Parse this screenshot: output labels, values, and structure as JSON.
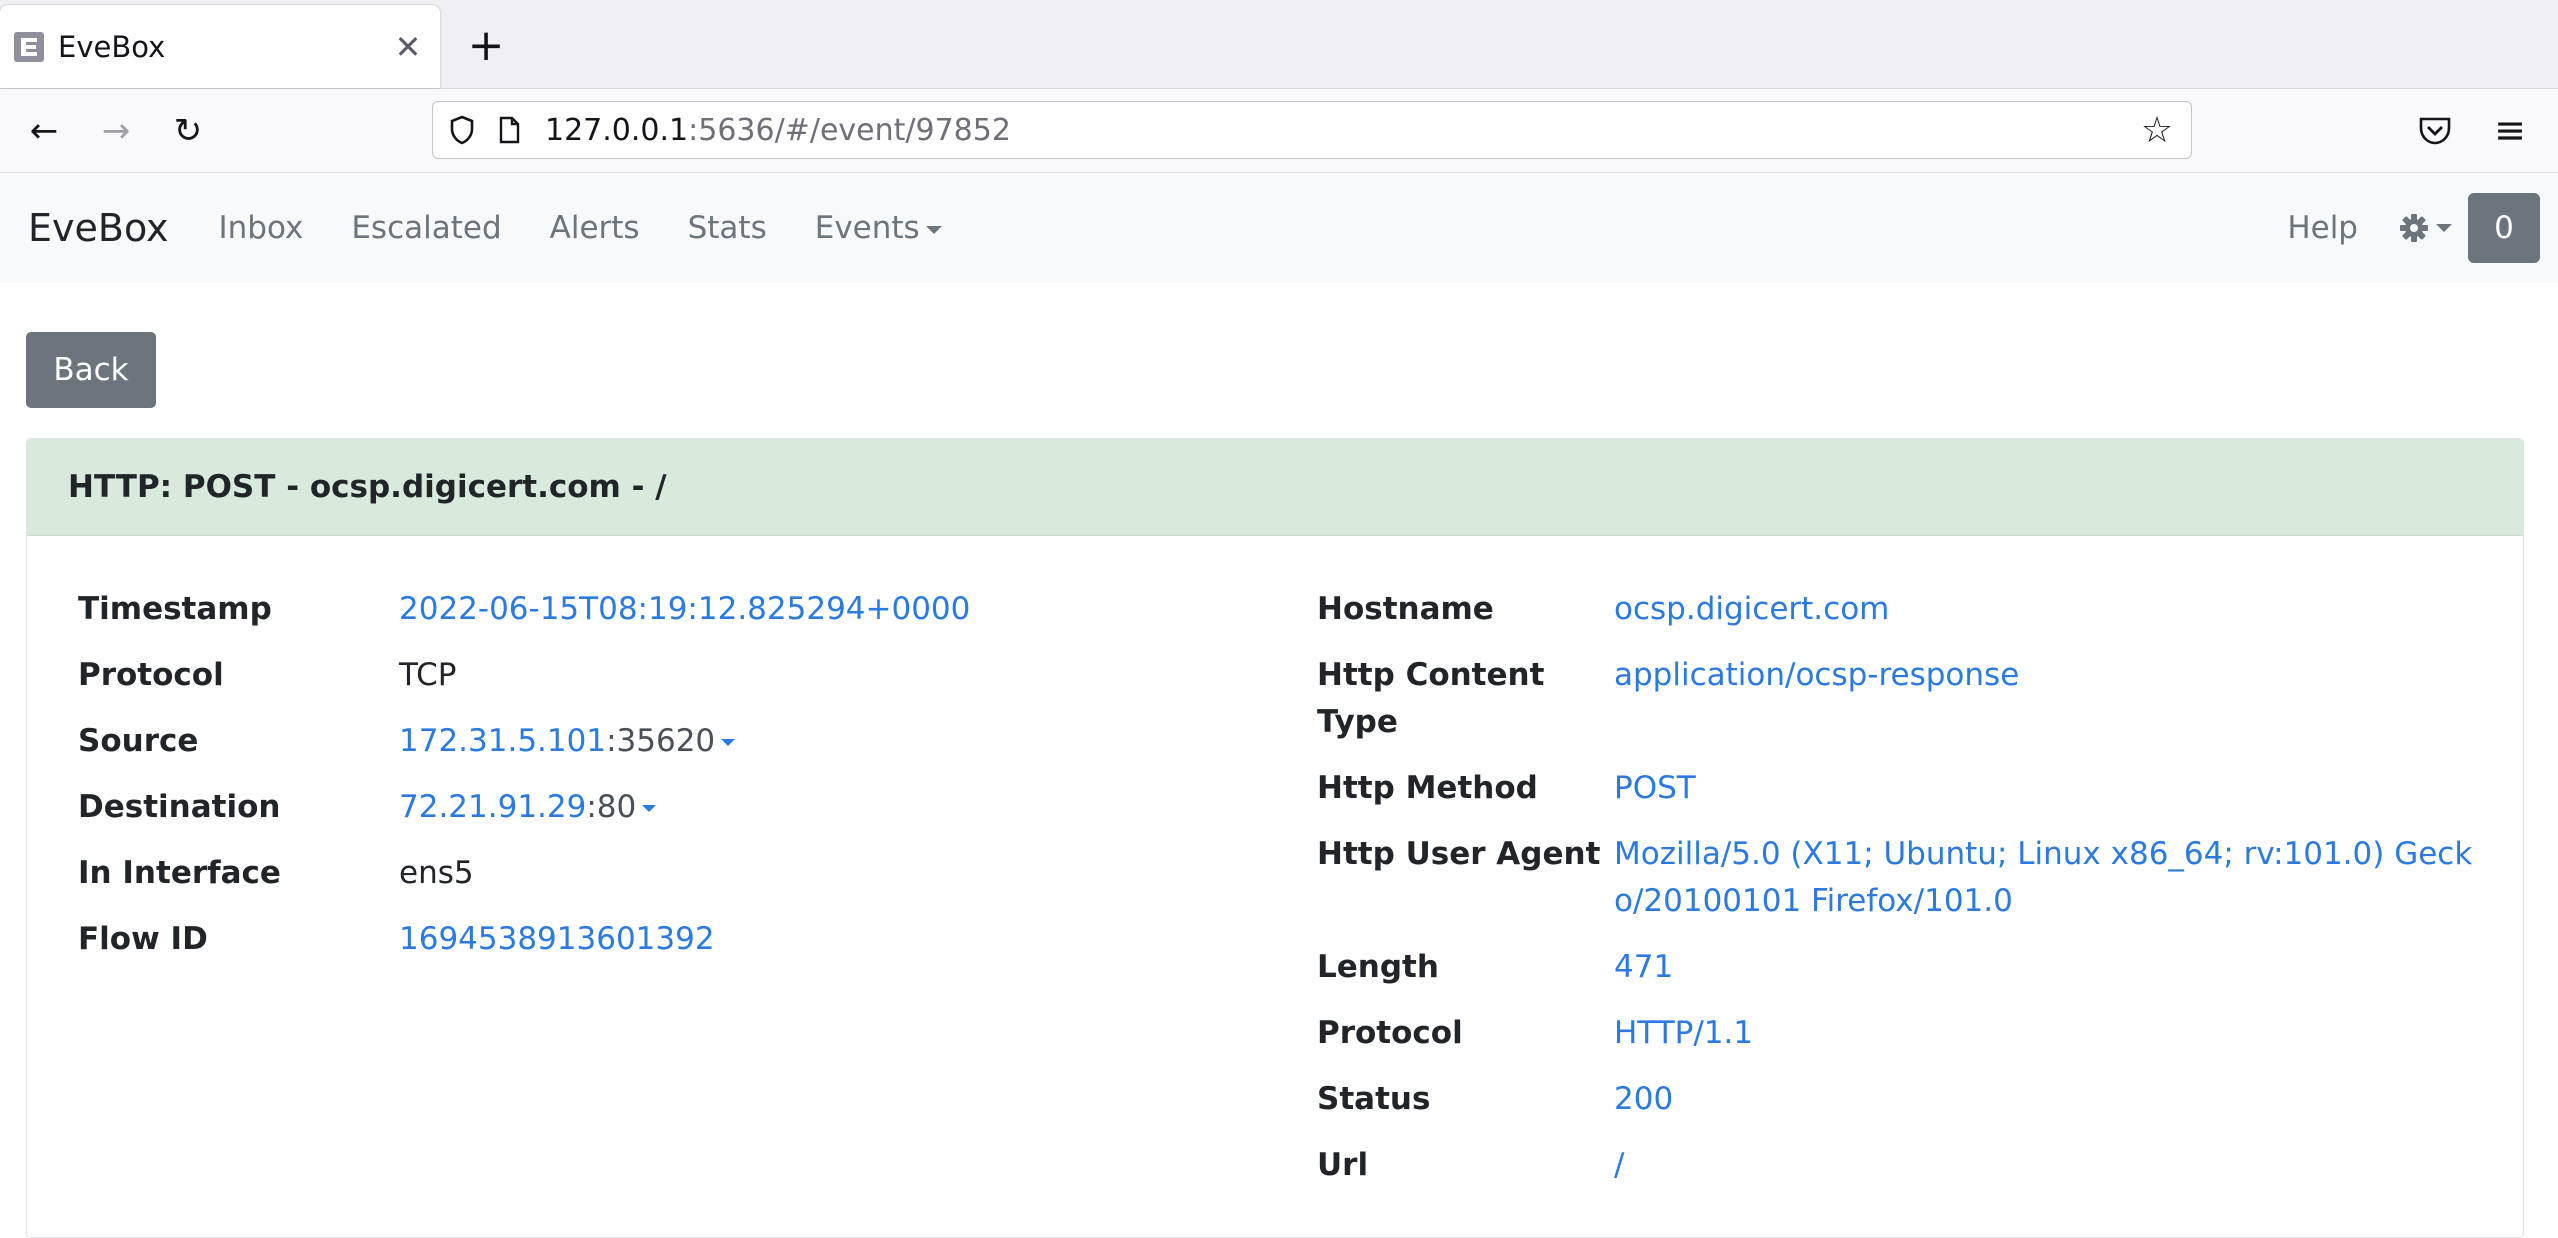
{
  "browser": {
    "tab_title": "EveBox",
    "url_host": "127.0.0.1",
    "url_rest": ":5636/#/event/97852"
  },
  "app_nav": {
    "brand": "EveBox",
    "items": [
      "Inbox",
      "Escalated",
      "Alerts",
      "Stats",
      "Events"
    ],
    "help": "Help",
    "count": "0"
  },
  "back_label": "Back",
  "event": {
    "title": "HTTP: POST - ocsp.digicert.com - /",
    "left": {
      "timestamp_label": "Timestamp",
      "timestamp": "2022-06-15T08:19:12.825294+0000",
      "protocol_label": "Protocol",
      "protocol": "TCP",
      "source_label": "Source",
      "source_ip": "172.31.5.101",
      "source_port": ":35620",
      "destination_label": "Destination",
      "destination_ip": "72.21.91.29",
      "destination_port": ":80",
      "in_interface_label": "In Interface",
      "in_interface": "ens5",
      "flow_id_label": "Flow ID",
      "flow_id": "1694538913601392"
    },
    "right": {
      "hostname_label": "Hostname",
      "hostname": "ocsp.digicert.com",
      "content_type_label": "Http Content Type",
      "content_type": "application/ocsp-response",
      "method_label": "Http Method",
      "method": "POST",
      "user_agent_label": "Http User Agent",
      "user_agent": "Mozilla/5.0 (X11; Ubuntu; Linux x86_64; rv:101.0) Gecko/20100101 Firefox/101.0",
      "length_label": "Length",
      "length": "471",
      "protocol_label": "Protocol",
      "protocol": "HTTP/1.1",
      "status_label": "Status",
      "status": "200",
      "url_label": "Url",
      "url": "/"
    }
  }
}
